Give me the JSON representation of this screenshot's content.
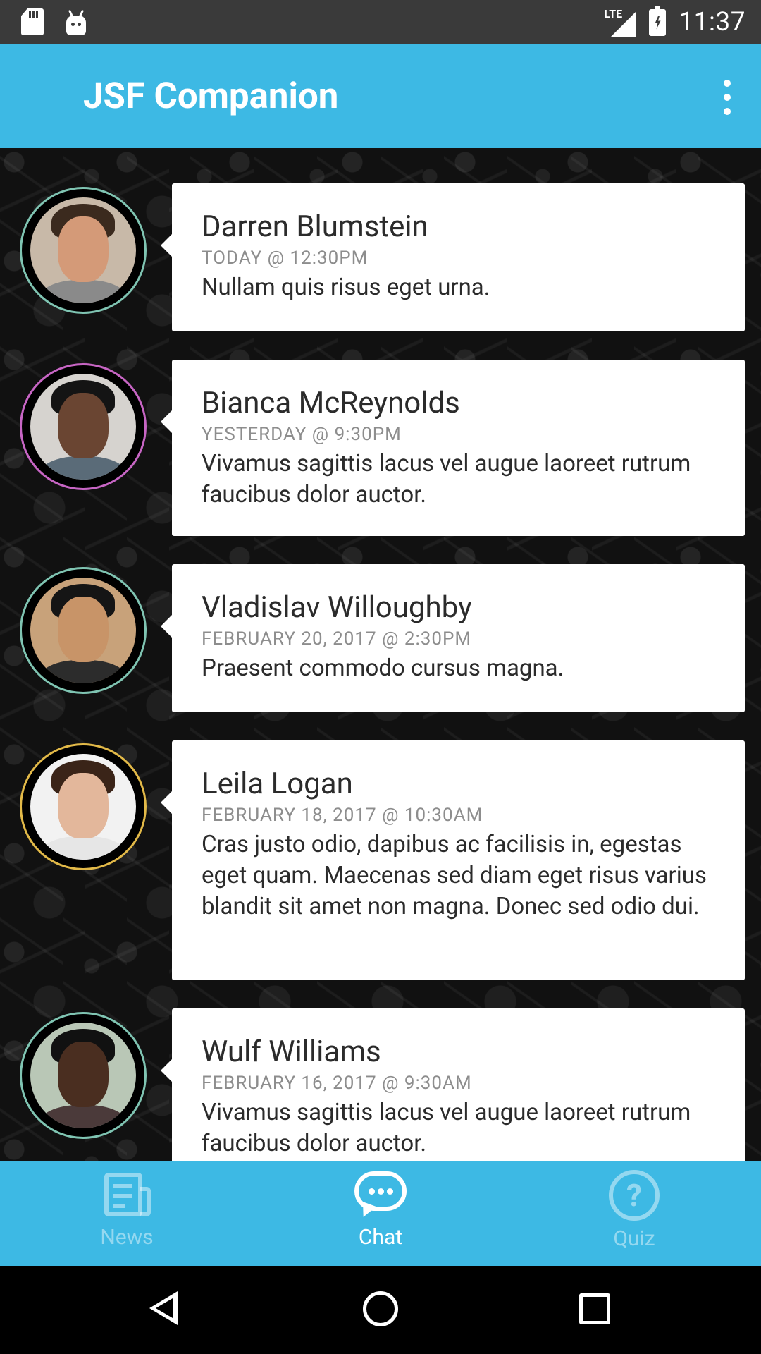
{
  "status_bar": {
    "network_label": "LTE",
    "time": "11:37"
  },
  "app_bar": {
    "title": "JSF Companion"
  },
  "messages": [
    {
      "name": "Darren Blumstein",
      "time": "TODAY @ 12:30PM",
      "text": "Nullam quis risus eget urna.",
      "ring_color": "#7fc4b2",
      "skin": "#d49a78",
      "hair": "#3b2a1e",
      "shirt": "#8a8a8a",
      "bg": "#c8b9a8"
    },
    {
      "name": "Bianca McReynolds",
      "time": "YESTERDAY @ 9:30PM",
      "text": "Vivamus sagittis lacus vel augue laoreet rutrum faucibus dolor auctor.",
      "ring_color": "#c765c4",
      "skin": "#6a4532",
      "hair": "#141414",
      "shirt": "#5a6b78",
      "bg": "#d6d3cf"
    },
    {
      "name": "Vladislav Willoughby",
      "time": "FEBRUARY 20, 2017 @ 2:30PM",
      "text": "Praesent commodo cursus magna.",
      "ring_color": "#7fc4b2",
      "skin": "#c89468",
      "hair": "#151515",
      "shirt": "#2c2c2c",
      "bg": "#c8a27a"
    },
    {
      "name": "Leila Logan",
      "time": "FEBRUARY 18, 2017 @ 10:30AM",
      "text": "Cras justo odio, dapibus ac facilisis in, egestas eget quam. Maecenas sed diam eget risus varius blandit sit amet non magna. Donec sed odio dui.",
      "ring_color": "#e2b948",
      "skin": "#e3b79b",
      "hair": "#3a2418",
      "shirt": "#e6e6e6",
      "bg": "#f2f2f2"
    },
    {
      "name": "Wulf Williams",
      "time": "FEBRUARY 16, 2017 @ 9:30AM",
      "text": "Vivamus sagittis lacus vel augue laoreet rutrum faucibus dolor auctor.",
      "ring_color": "#7fc4b2",
      "skin": "#4a2e20",
      "hair": "#111111",
      "shirt": "#4b3a3a",
      "bg": "#b9c7b6"
    }
  ],
  "bottom_nav": [
    {
      "label": "News",
      "icon": "newspaper-icon",
      "active": false
    },
    {
      "label": "Chat",
      "icon": "chat-bubble-icon",
      "active": true
    },
    {
      "label": "Quiz",
      "icon": "question-circle-icon",
      "active": false
    }
  ],
  "colors": {
    "accent": "#3db9e4",
    "status_bar": "#3a3a3a"
  }
}
